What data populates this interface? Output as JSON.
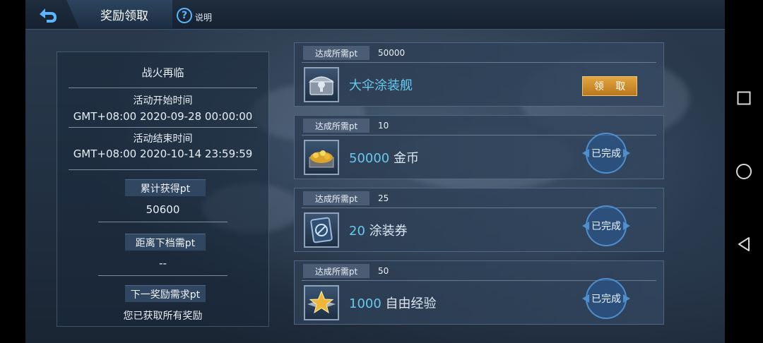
{
  "header": {
    "title": "奖励领取",
    "help_label": "说明"
  },
  "info_panel": {
    "event_name": "战火再临",
    "start_label": "活动开始时间",
    "start_time": "GMT+08:00 2020-09-28 00:00:00",
    "end_label": "活动结束时间",
    "end_time": "GMT+08:00 2020-10-14 23:59:59",
    "total_label": "累计获得pt",
    "total_value": "50600",
    "next_tier_label": "距离下档需pt",
    "next_tier_value": "--",
    "next_reward_label": "下一奖励需求pt",
    "next_reward_value": "您已获取所有奖励"
  },
  "rewards": [
    {
      "req_label": "达成所需pt",
      "req_value": "50000",
      "amount": "",
      "name": "大伞涂装舰",
      "action": "领 取",
      "status": "claimable",
      "icon": "chest-icon"
    },
    {
      "req_label": "达成所需pt",
      "req_value": "10",
      "amount": "50000",
      "name": "金币",
      "action": "已完成",
      "status": "done",
      "icon": "gold-coins-icon"
    },
    {
      "req_label": "达成所需pt",
      "req_value": "25",
      "amount": "20",
      "name": "涂装券",
      "action": "已完成",
      "status": "done",
      "icon": "skin-ticket-icon"
    },
    {
      "req_label": "达成所需pt",
      "req_value": "50",
      "amount": "1000",
      "name": "自由经验",
      "action": "已完成",
      "status": "done",
      "icon": "star-exp-icon"
    }
  ],
  "colors": {
    "accent_blue": "#66c8f0",
    "claim_button": "#d6952f",
    "panel_bg": "#2d3e52"
  },
  "system_nav": {
    "icons": [
      "recents-square-icon",
      "home-circle-icon",
      "back-triangle-icon"
    ]
  }
}
